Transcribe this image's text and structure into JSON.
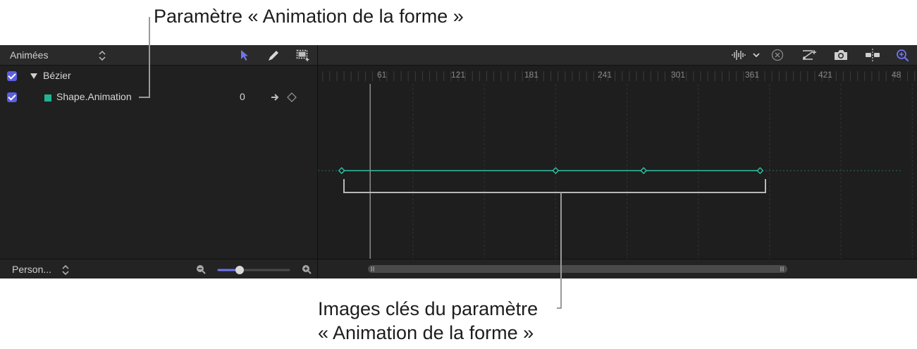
{
  "callouts": {
    "top": "Paramètre « Animation de la forme »",
    "bottom_line1": "Images clés du paramètre",
    "bottom_line2": "« Animation de la forme »"
  },
  "left_panel": {
    "filter_label": "Animées",
    "rows": [
      {
        "label": "Bézier",
        "checked": true,
        "expanded": true
      },
      {
        "label": "Shape.Animation",
        "checked": true,
        "value": "0"
      }
    ],
    "footer_label": "Person...",
    "zoom_slider_level": 0.3
  },
  "timeline": {
    "ruler_labels": [
      "61",
      "121",
      "181",
      "241",
      "301",
      "361",
      "421",
      "48"
    ],
    "curve_color": "#2ec4a4",
    "keyframes": [
      {
        "frame": 1,
        "value": 0
      },
      {
        "frame": 181,
        "value": 0
      },
      {
        "frame": 255,
        "value": 0
      },
      {
        "frame": 353,
        "value": 0
      }
    ],
    "playhead_frame": 25,
    "visible_range": [
      -19,
      485
    ]
  },
  "colors": {
    "accent": "#5a5fe0",
    "panel_bg": "#1e1e1e",
    "header_bg": "#2a2a2a",
    "curve": "#2ec4a4"
  }
}
